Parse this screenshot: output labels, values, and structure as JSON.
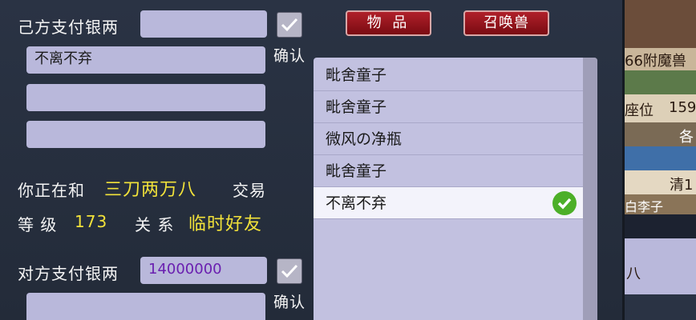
{
  "my_silver": {
    "label": "己方支付银两",
    "value": "",
    "confirm": "确认"
  },
  "my_items": [
    "不离不弃",
    "",
    ""
  ],
  "trade_info": {
    "prefix": "你正在和",
    "partner": "三刀两万八",
    "suffix": "交易",
    "level_label": "等 级",
    "level_value": "173",
    "relation_label": "关 系",
    "relation_value": "临时好友"
  },
  "their_silver": {
    "label": "对方支付银两",
    "value": "14000000",
    "confirm": "确认"
  },
  "tabs": {
    "items": "物 品",
    "summon": "召唤兽"
  },
  "item_list": [
    {
      "name": "毗舍童子",
      "selected": false
    },
    {
      "name": "毗舍童子",
      "selected": false
    },
    {
      "name": "微风の净瓶",
      "selected": false
    },
    {
      "name": "毗舍童子",
      "selected": false
    },
    {
      "name": "不离不弃",
      "selected": true
    }
  ],
  "side_panel": {
    "t1": "66附魔兽",
    "t2": "座位",
    "t3": "159",
    "t4": "各",
    "t5": "清1",
    "t6": "白李子",
    "t7": "八"
  },
  "colors": {
    "accent_yellow": "#f2e23a",
    "silver_purple": "#6a1fb0",
    "button_red": "#9a1520",
    "field_lavender": "#b9b8db"
  }
}
